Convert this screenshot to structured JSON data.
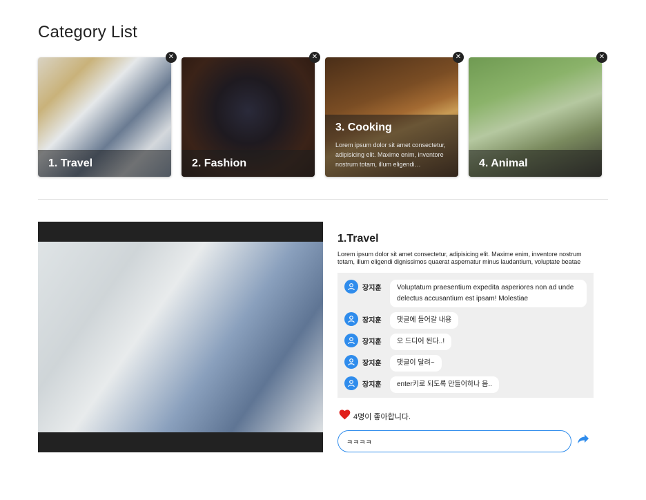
{
  "page": {
    "title": "Category List"
  },
  "categories": [
    {
      "label": "1. Travel",
      "description": ""
    },
    {
      "label": "2. Fashion",
      "description": ""
    },
    {
      "label": "3. Cooking",
      "description": "Lorem ipsum dolor sit amet consectetur, adipisicing elit. Maxime enim, inventore nostrum totam, illum eligendi dignissimos quaerat aspernatur minus laudantium, voluptate beatae"
    },
    {
      "label": "4. Animal",
      "description": ""
    }
  ],
  "close_icon": "close-icon",
  "detail": {
    "title": "1.Travel",
    "description": "Lorem ipsum dolor sit amet consectetur, adipisicing elit. Maxime enim, inventore nostrum totam, illum eligendi dignissimos quaerat aspernatur minus laudantium, voluptate beatae"
  },
  "comments": [
    {
      "user": "장지훈",
      "text": "Voluptatum praesentium expedita asperiores non ad unde delectus accusantium est ipsam! Molestiae"
    },
    {
      "user": "장지훈",
      "text": "댓글에 들어갈 내용"
    },
    {
      "user": "장지훈",
      "text": "오 드디어 된다..!"
    },
    {
      "user": "장지훈",
      "text": "댓글이 달려~"
    },
    {
      "user": "장지훈",
      "text": "enter키로 되도록 만들어하나 음.."
    }
  ],
  "likes": {
    "text": "4명이 좋아합니다.",
    "icon": "heart-icon"
  },
  "comment_input": {
    "value": "ㅋㅋㅋㅋ",
    "placeholder": ""
  },
  "colors": {
    "accent": "#2f8cec",
    "heart": "#e0201c",
    "comment_bg": "#efefef",
    "image_frame": "#222222"
  }
}
